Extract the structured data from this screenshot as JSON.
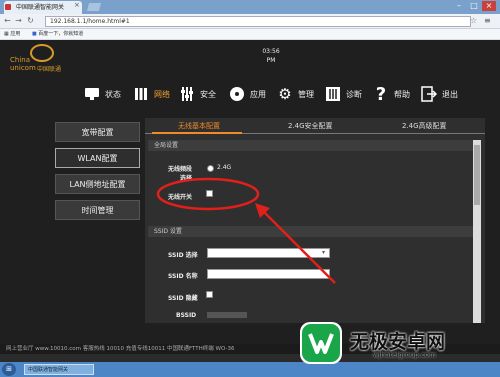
{
  "browser": {
    "tab_title": "中国联通智能网关",
    "url": "192.168.1.1/home.html#1",
    "bookmarks_label": "应用",
    "bookmark_1": "百度一下，你就知道"
  },
  "header": {
    "logo_china": "China",
    "logo_unicom": "unicom",
    "logo_cn": "中国联通",
    "time": "03:56",
    "ampm": "PM"
  },
  "nav": {
    "status": "状态",
    "network": "网络",
    "security": "安全",
    "apps": "应用",
    "manage": "管理",
    "diagnose": "诊断",
    "help": "帮助",
    "logout": "退出"
  },
  "sidebar": {
    "items": [
      {
        "label": "宽带配置"
      },
      {
        "label": "WLAN配置"
      },
      {
        "label": "LAN侧地址配置"
      },
      {
        "label": "时间管理"
      }
    ]
  },
  "tabs": [
    {
      "label": "无线基本配置"
    },
    {
      "label": "2.4G安全配置"
    },
    {
      "label": "2.4G高级配置"
    }
  ],
  "global": {
    "heading": "全局设置",
    "band_label": "无线频段",
    "band_label2": "选择",
    "band_value": "2.4G",
    "switch_label": "无线开关"
  },
  "ssid": {
    "heading": "SSID 设置",
    "select_label": "SSID 选择",
    "name_label": "SSID 名称",
    "hide_label": "SSID 隐藏",
    "bssid_label": "BSSID"
  },
  "footer": {
    "text": "网上营业厅 www.10010.com 客服热线 10010 充值专线10011 中国联通FTTH终端 WO-36"
  },
  "taskbar": {
    "task1": "中国联通智能网关"
  },
  "watermark": {
    "text": "无极安卓网",
    "url": "wjhotelgroup.com"
  },
  "colors": {
    "accent": "#f08a2a",
    "annotation": "#e0201a"
  }
}
